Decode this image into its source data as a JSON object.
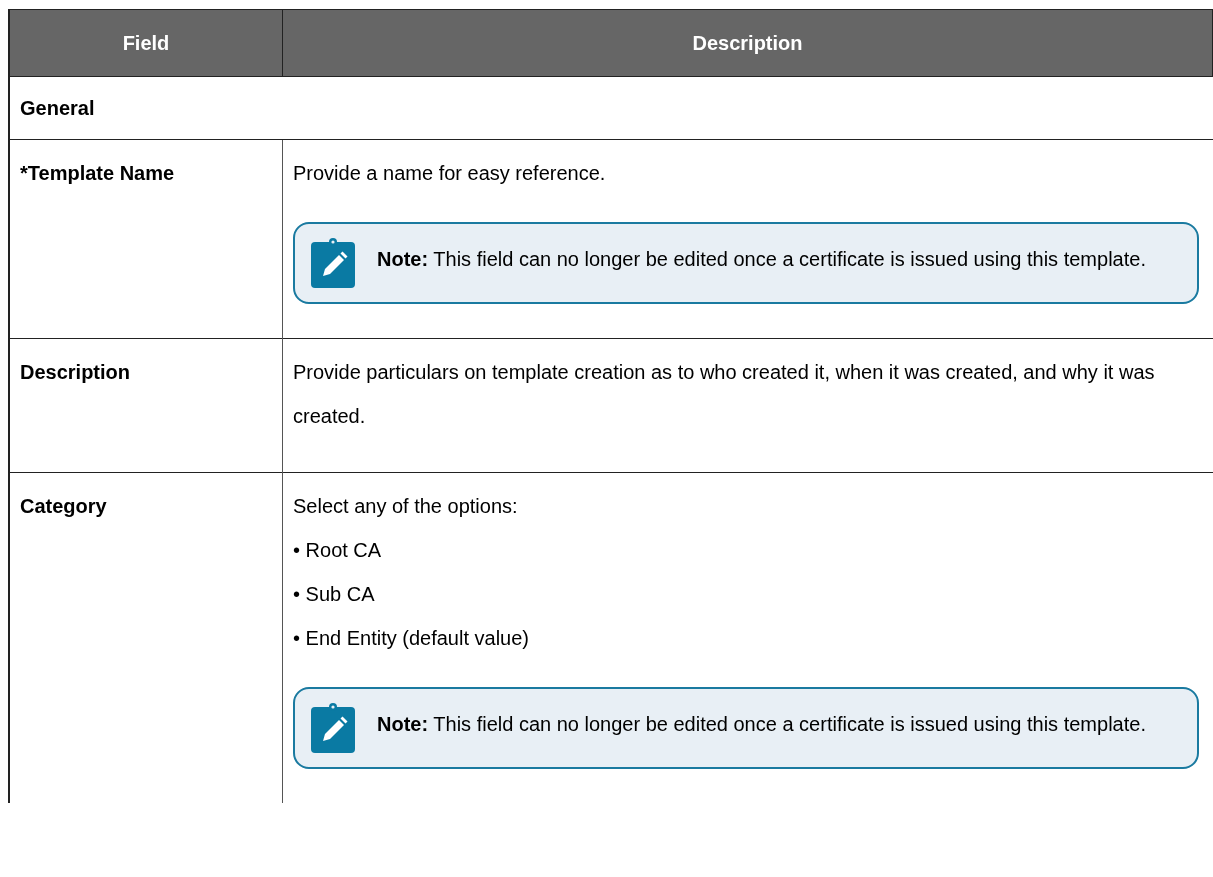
{
  "table": {
    "columns": [
      "Field",
      "Description"
    ],
    "rows": [
      {
        "kind": "section",
        "label": "General"
      },
      {
        "kind": "field",
        "field": "*Template Name",
        "content": [
          {
            "kind": "text",
            "text": "Provide a name for easy reference."
          },
          {
            "kind": "note",
            "text": "**Note:** This field can no longer be edited once a certificate is issued using this template."
          }
        ]
      },
      {
        "kind": "field",
        "field": "Description",
        "content": [
          {
            "kind": "text",
            "text": "Provide particulars on template creation as to who created it, when it was created, and why it was created."
          }
        ]
      },
      {
        "kind": "field",
        "field": "Category",
        "content": [
          {
            "kind": "text",
            "text": "Select any of the options:"
          },
          {
            "kind": "bullets",
            "items": [
              "• Root CA",
              "• Sub CA",
              "• End Entity (default value)"
            ]
          },
          {
            "kind": "note",
            "text": "**Note:** This field can no longer be edited once a certificate is issued using this template."
          }
        ]
      }
    ]
  }
}
